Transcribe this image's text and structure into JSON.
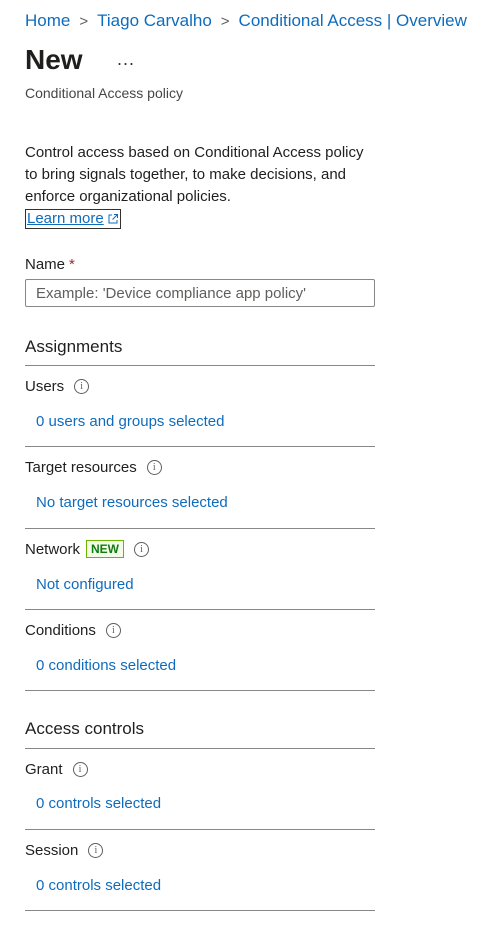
{
  "breadcrumb": {
    "items": [
      "Home",
      "Tiago Carvalho",
      "Conditional Access | Overview"
    ],
    "separator": ">"
  },
  "page": {
    "title": "New",
    "more_label": "...",
    "subtitle": "Conditional Access policy",
    "description": "Control access based on Conditional Access policy to bring signals together, to make decisions, and enforce organizational policies.",
    "learn_more": "Learn more"
  },
  "name_field": {
    "label": "Name",
    "required_mark": "*",
    "placeholder": "Example: 'Device compliance app policy'",
    "value": ""
  },
  "assignments": {
    "heading": "Assignments",
    "users": {
      "label": "Users",
      "value": "0 users and groups selected"
    },
    "target_resources": {
      "label": "Target resources",
      "value": "No target resources selected"
    },
    "network": {
      "label": "Network",
      "badge": "NEW",
      "value": "Not configured"
    },
    "conditions": {
      "label": "Conditions",
      "value": "0 conditions selected"
    }
  },
  "access_controls": {
    "heading": "Access controls",
    "grant": {
      "label": "Grant",
      "value": "0 controls selected"
    },
    "session": {
      "label": "Session",
      "value": "0 controls selected"
    }
  },
  "icons": {
    "info": "info-icon",
    "external_link": "external-link-icon"
  },
  "colors": {
    "link": "#0f6cbd",
    "required": "#a4262c",
    "badge_text": "#107c10",
    "badge_border": "#6bb700"
  }
}
